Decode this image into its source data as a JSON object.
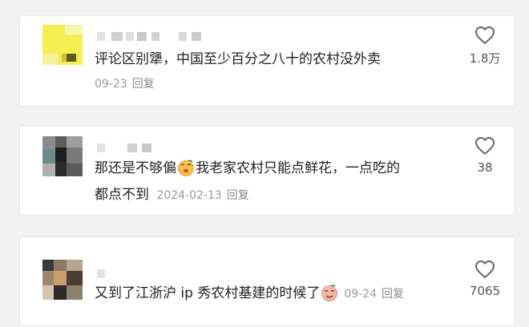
{
  "comments": [
    {
      "text": "评论区别犟，中国至少百分之八十的农村没外卖",
      "date": "09-23",
      "reply_label": "回复",
      "like_count": "1.8万"
    },
    {
      "text_part1": "那还是不够偏",
      "text_part2": "我老家农村只能点鲜花，一点吃的",
      "text_line2": "都点不到",
      "emoji": "smirk-face",
      "date": "2024-02-13",
      "reply_label": "回复",
      "like_count": "38"
    },
    {
      "text_part1": "又到了江浙沪 ip 秀农村基建的时候了",
      "emoji": "sly-face",
      "date": "09-24",
      "reply_label": "回复",
      "like_count": "7065"
    }
  ],
  "icons": {
    "like": "heart-outline-icon"
  },
  "colors": {
    "background": "#f2f2f2",
    "card": "#ffffff",
    "text": "#1f1f1f",
    "meta": "#9a9a9a"
  }
}
